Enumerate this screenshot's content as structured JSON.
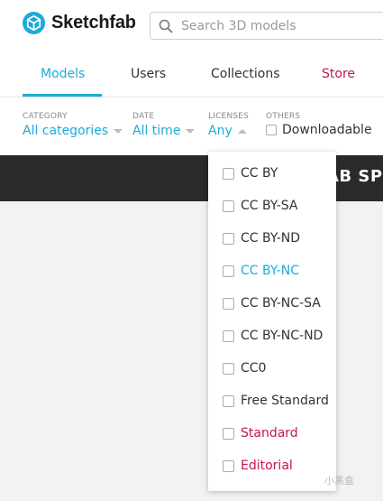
{
  "header": {
    "brand": "Sketchfab",
    "search_placeholder": "Search 3D models"
  },
  "tabs": [
    {
      "label": "Models",
      "active": true
    },
    {
      "label": "Users"
    },
    {
      "label": "Collections"
    },
    {
      "label": "Store"
    }
  ],
  "filters": {
    "category": {
      "label": "CATEGORY",
      "value": "All categories"
    },
    "date": {
      "label": "DATE",
      "value": "All time"
    },
    "licenses": {
      "label": "LICENSES",
      "value": "Any"
    },
    "others": {
      "label": "OTHERS",
      "value": "Downloadable"
    }
  },
  "banner": {
    "text": "AB SPR"
  },
  "licenses_menu": [
    {
      "label": "CC BY"
    },
    {
      "label": "CC BY-SA"
    },
    {
      "label": "CC BY-ND"
    },
    {
      "label": "CC BY-NC",
      "highlighted": true
    },
    {
      "label": "CC BY-NC-SA"
    },
    {
      "label": "CC BY-NC-ND"
    },
    {
      "label": "CC0"
    },
    {
      "label": "Free Standard"
    },
    {
      "label": "Standard"
    },
    {
      "label": "Editorial"
    }
  ],
  "colors": {
    "accent": "#1caad9",
    "store": "#c0174c",
    "banner": "#2a2a2a"
  },
  "watermark": "小黑盒"
}
